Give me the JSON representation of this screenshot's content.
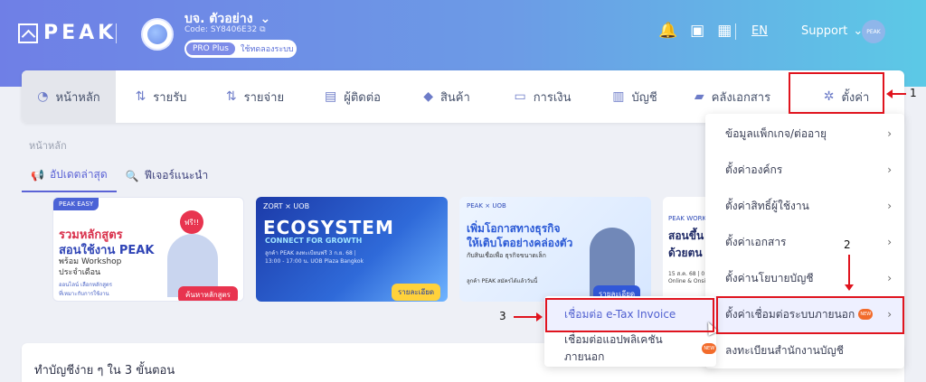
{
  "header": {
    "logo_text": "PEAK",
    "company_name": "บจ. ตัวอย่าง",
    "company_code": "Code: SY8406E32",
    "plan_badge": "PRO Plus",
    "plan_trial": "ใช้ทดลองระบบ",
    "language": "EN",
    "support_label": "Support",
    "avatar_text": "PEAK"
  },
  "nav": {
    "items": [
      {
        "label": "หน้าหลัก",
        "icon": "dashboard-icon"
      },
      {
        "label": "รายรับ",
        "icon": "income-icon"
      },
      {
        "label": "รายจ่าย",
        "icon": "expense-icon"
      },
      {
        "label": "ผู้ติดต่อ",
        "icon": "contacts-icon"
      },
      {
        "label": "สินค้า",
        "icon": "box-icon"
      },
      {
        "label": "การเงิน",
        "icon": "money-icon"
      },
      {
        "label": "บัญชี",
        "icon": "book-icon"
      },
      {
        "label": "คลังเอกสาร",
        "icon": "folder-icon"
      },
      {
        "label": "ตั้งค่า",
        "icon": "gear-icon"
      }
    ]
  },
  "breadcrumb": "หน้าหลัก",
  "tabs": [
    {
      "label": "อัปเดตล่าสุด",
      "icon": "megaphone-icon"
    },
    {
      "label": "ฟีเจอร์แนะนำ",
      "icon": "search-icon"
    }
  ],
  "banners": {
    "b1": {
      "tag": "PEAK EASY",
      "free": "ฟรี!!",
      "line1": "รวมหลักสูตร",
      "line2": "สอนใช้งาน PEAK",
      "line3": "พร้อม Workshop",
      "line4": "ประจำเดือน",
      "small": "ออนไลน์ เลือกหลักสูตรที่เหมาะกับการใช้งานของคุณ",
      "button": "ค้นหาหลักสูตร"
    },
    "b2": {
      "brand": "ZORT × UOB",
      "title": "ECOSYSTEM",
      "subtitle": "CONNECT FOR GROWTH",
      "info": "ลูกค้า PEAK ลงทะเบียนฟรี 3 ก.ย. 68 | 13:00 - 17:00 น. UOB Plaza Bangkok",
      "button": "รายละเอียด"
    },
    "b3": {
      "brand": "PEAK × UOB",
      "line1": "เพิ่มโอกาสทางธุรกิจ",
      "line2": "ให้เติบโตอย่างคล่องตัว",
      "line3": "กับสินเชื่อเพื่อ ธุรกิจขนาดเล็ก",
      "line4": "ลูกค้า PEAK สมัครได้แล้ววันนี้",
      "button": "รายละเอียด"
    },
    "b4": {
      "brand": "PEAK WORK",
      "line1": "สอนขึ้น ด้วยตน",
      "line3": "15 ส.ค. 68 | 0 Online & Onsi"
    }
  },
  "settings_menu": {
    "items": [
      {
        "label": "ข้อมูลแพ็กเกจ/ต่ออายุ"
      },
      {
        "label": "ตั้งค่าองค์กร"
      },
      {
        "label": "ตั้งค่าสิทธิ์ผู้ใช้งาน"
      },
      {
        "label": "ตั้งค่าเอกสาร"
      },
      {
        "label": "ตั้งค่านโยบายบัญชี"
      },
      {
        "label": "ตั้งค่าเชื่อมต่อระบบภายนอก"
      },
      {
        "label": "ลงทะเบียนสำนักงานบัญชี"
      }
    ],
    "new_badge": "NEW"
  },
  "submenu": {
    "items": [
      {
        "label": "เชื่อมต่อ e-Tax Invoice"
      },
      {
        "label": "เชื่อมต่อแอปพลิเคชันภายนอก"
      }
    ]
  },
  "bottom_card_title": "ทำบัญชีง่าย ๆ ใน 3 ขั้นตอน",
  "annotations": {
    "step1": "1",
    "step2": "2",
    "step3": "3"
  },
  "colors": {
    "accent": "#5b63d6",
    "highlight_box": "#e0141e",
    "header_start": "#6f7fe6",
    "header_end": "#5cc9e6"
  }
}
